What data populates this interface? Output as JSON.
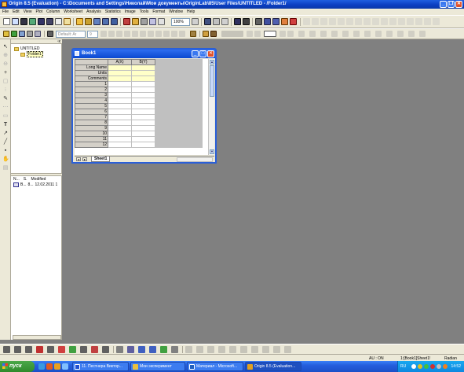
{
  "app": {
    "title": "Origin 8.5 (Evaluation) - C:\\Documents and Settings\\Николай\\Мои документы\\OriginLab\\85\\User Files\\UNTITLED - /Folder1/"
  },
  "menu": [
    "File",
    "Edit",
    "View",
    "Plot",
    "Column",
    "Worksheet",
    "Analysis",
    "Statistics",
    "Image",
    "Tools",
    "Format",
    "Window",
    "Help"
  ],
  "toolbar": {
    "zoom": "100%",
    "font_name": "Default: Ar",
    "font_size": "9"
  },
  "left_tools": [
    "pointer",
    "zoom-in",
    "zoom-out",
    "data-reader",
    "scale",
    "screen-reader",
    "draw-data",
    "mask",
    "region",
    "text",
    "arrow",
    "line",
    "rectangle",
    "pan",
    "annotation"
  ],
  "project_explorer": {
    "root": "UNTITLED",
    "folder": "Folder1",
    "columns": [
      "N...",
      "S.",
      "Modified"
    ],
    "items": [
      {
        "name": "B...",
        "size": "8...",
        "modified": "12.02.2011 1"
      }
    ]
  },
  "workbook": {
    "title": "Book1",
    "corner": "",
    "columns": [
      "A(X)",
      "B(Y)"
    ],
    "meta_rows": [
      "Long Name",
      "Units",
      "Comments"
    ],
    "rows": [
      "1",
      "2",
      "3",
      "4",
      "5",
      "6",
      "7",
      "8",
      "9",
      "10",
      "11",
      "12"
    ],
    "sheet_tab": "Sheet1"
  },
  "status": {
    "au": "AU : ON",
    "sheet": "1:[Book1]Sheet1!",
    "angle": "Radian"
  },
  "taskbar": {
    "start": "пуск",
    "tasks": [
      {
        "label": "11. Пестнера Виктор...",
        "color": "#2050d0"
      },
      {
        "label": "Мои эксперимент",
        "color": "#e8c040"
      },
      {
        "label": "Материал - Microsoft...",
        "color": "#2060c0"
      },
      {
        "label": "Origin 8.5 (Evaluation...",
        "color": "#e0a020"
      }
    ],
    "lang": "RU",
    "clock": "14:52"
  },
  "colors": {
    "title_blue": "#0a3cc0",
    "window_bg": "#808080",
    "meta_yellow": "#ffffc8"
  }
}
